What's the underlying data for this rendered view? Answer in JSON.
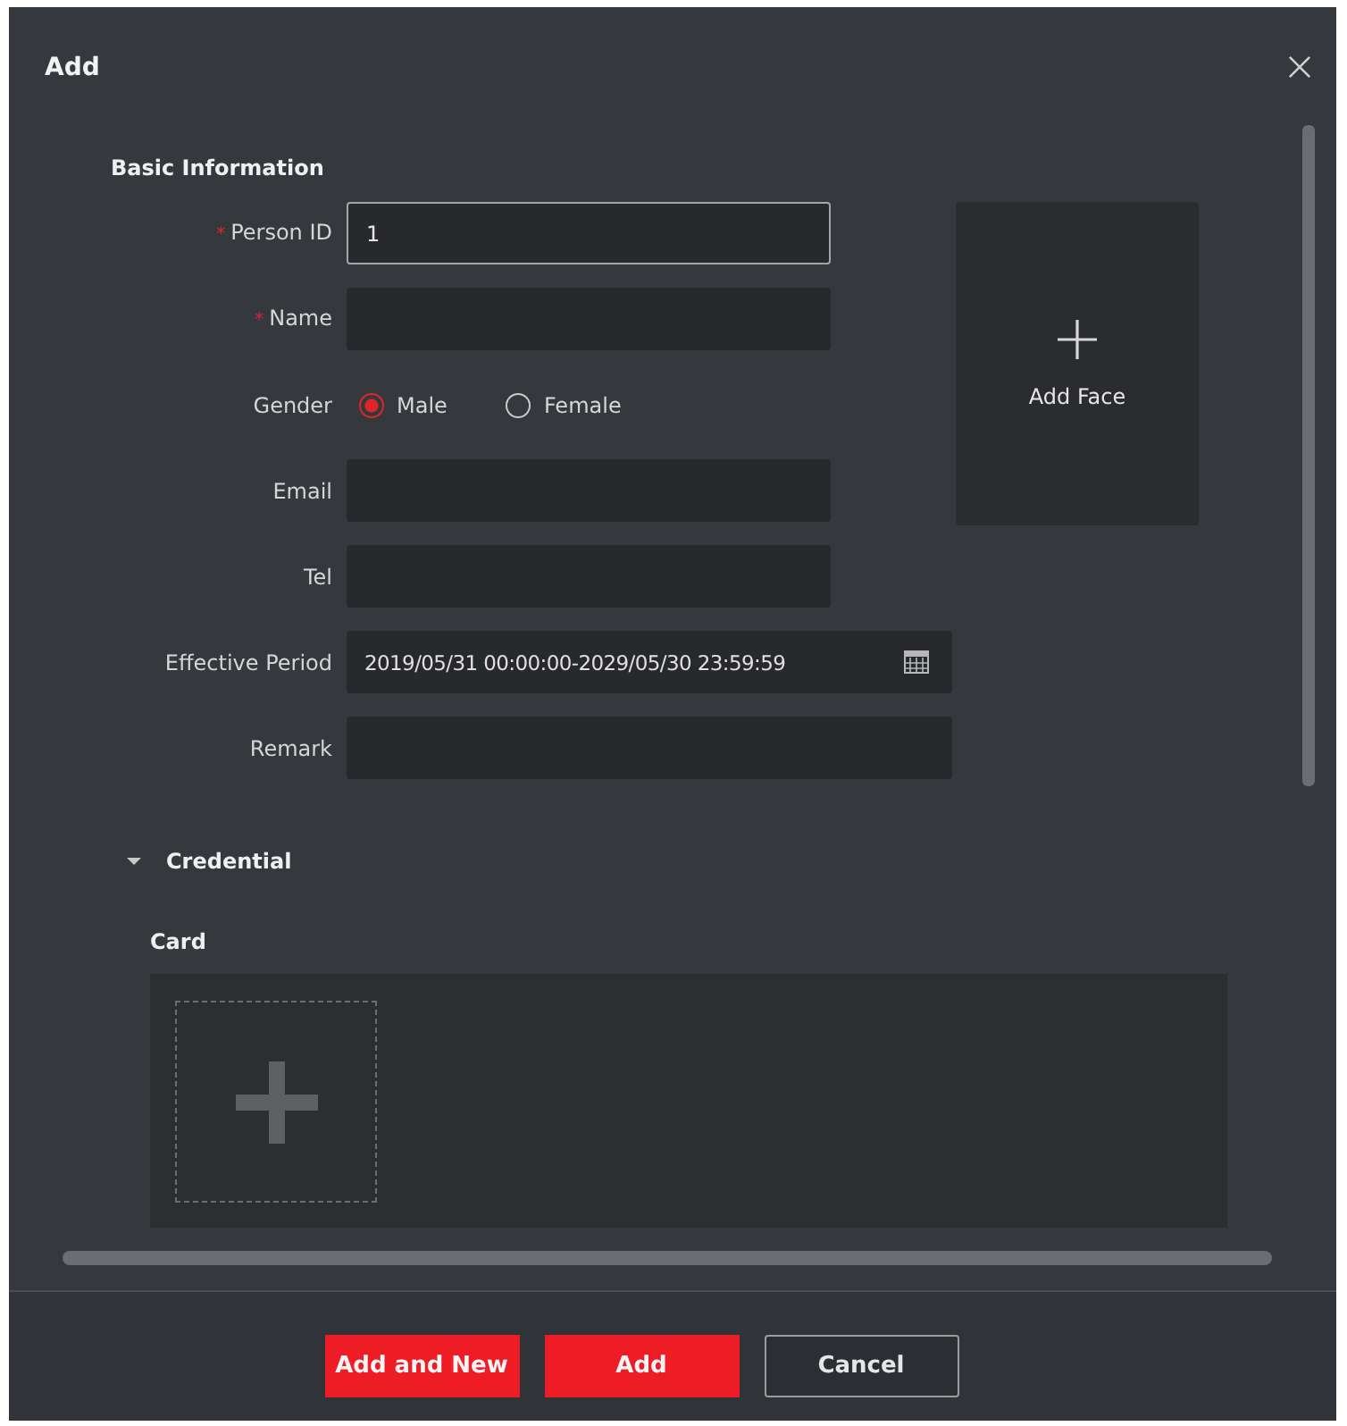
{
  "dialog": {
    "title": "Add"
  },
  "basic_information": {
    "heading": "Basic Information",
    "fields": [
      {
        "kind": "text",
        "label": "Person ID",
        "mark": "*",
        "value": "1",
        "focused": true
      },
      {
        "kind": "text",
        "label": "Name",
        "mark": "*",
        "focused": false
      },
      {
        "kind": "radio",
        "label": "Gender",
        "options": [
          {
            "label": "Male",
            "selected": true
          },
          {
            "label": "Female",
            "selected": false
          }
        ]
      },
      {
        "kind": "text",
        "label": "Email",
        "focused": false
      },
      {
        "kind": "text",
        "label": "Tel",
        "focused": false
      },
      {
        "kind": "date_range",
        "label": "Effective Period",
        "value": "2019/05/31 00:00:00-2029/05/30 23:59:59"
      },
      {
        "kind": "textarea",
        "label": "Remark",
        "focused": false
      }
    ]
  },
  "face": {
    "label": "Add Face"
  },
  "credential": {
    "title": "Credential",
    "expanded": true,
    "card": {
      "label": "Card"
    }
  },
  "buttons": [
    {
      "label": "Add and New",
      "kind": "primary"
    },
    {
      "label": "Add",
      "kind": "primary"
    },
    {
      "label": "Cancel",
      "kind": "secondary"
    }
  ]
}
